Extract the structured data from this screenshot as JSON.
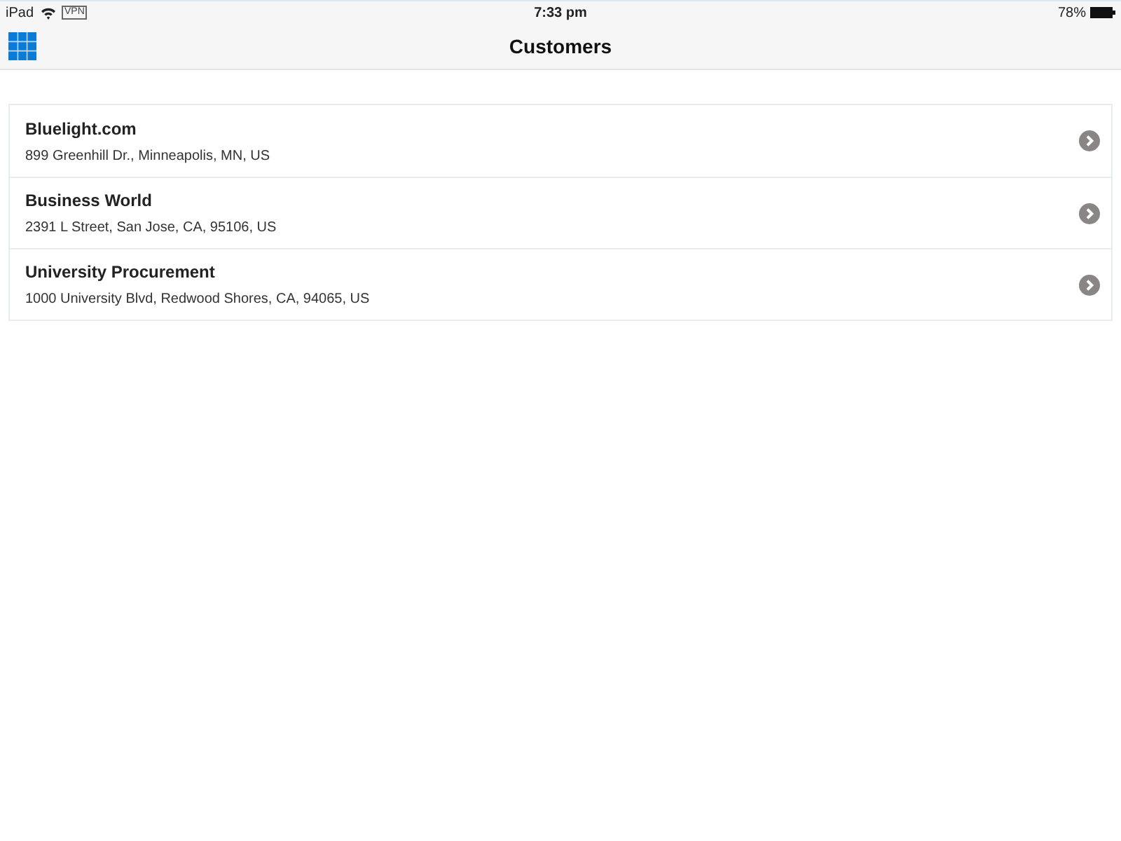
{
  "status_bar": {
    "device": "iPad",
    "vpn": "VPN",
    "time": "7:33 pm",
    "battery": "78%"
  },
  "nav_bar": {
    "title": "Customers"
  },
  "customers": [
    {
      "name": "Bluelight.com",
      "address": "899 Greenhill Dr., Minneapolis, MN, US"
    },
    {
      "name": "Business World",
      "address": "2391 L Street, San Jose, CA, 95106, US"
    },
    {
      "name": "University Procurement",
      "address": "1000 University Blvd, Redwood Shores, CA, 94065, US"
    }
  ]
}
